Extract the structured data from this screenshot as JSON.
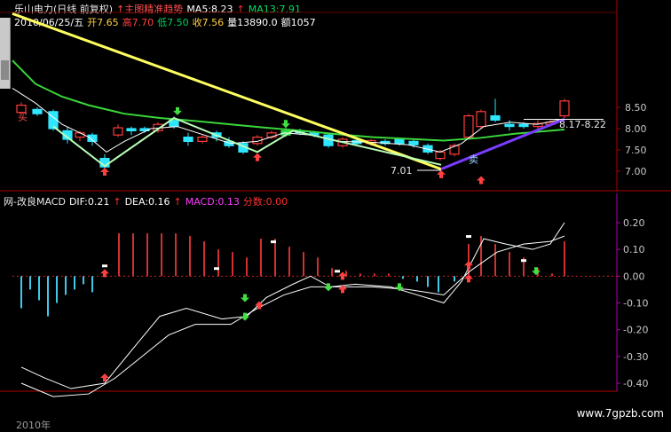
{
  "header": {
    "row1": [
      {
        "text": "乐山电力(日线 前复权)",
        "color": "#e8e8e8"
      },
      {
        "text": "↑主图精准趋势",
        "color": "#ff5050"
      },
      {
        "text": "MA5:8.23",
        "color": "#ffffff"
      },
      {
        "text": "↑",
        "color": "#ff3030"
      },
      {
        "text": "MA13:7.91",
        "color": "#00e060"
      }
    ],
    "row2": [
      {
        "text": "2010/06/25/五",
        "color": "#ffffff"
      },
      {
        "text": "开7.65",
        "color": "#ffd040"
      },
      {
        "text": "高7.70",
        "color": "#ff4040"
      },
      {
        "text": "低7.50",
        "color": "#00d060"
      },
      {
        "text": "收7.56",
        "color": "#ffd040"
      },
      {
        "text": "量13890.0",
        "color": "#ffffff"
      },
      {
        "text": "额1057",
        "color": "#ffffff"
      }
    ]
  },
  "macd_header": [
    {
      "text": "网-改良MACD",
      "color": "#e8e8e8"
    },
    {
      "text": "DIF:0.21",
      "color": "#ffffff"
    },
    {
      "text": "↑",
      "color": "#ff3030"
    },
    {
      "text": "DEA:0.16",
      "color": "#ffffff"
    },
    {
      "text": "↑",
      "color": "#ff3030"
    },
    {
      "text": "MACD:0.13",
      "color": "#ff3cff"
    },
    {
      "text": "分数:0.00",
      "color": "#ff3030"
    }
  ],
  "price_panel": {
    "y_ticks": [
      "8.50",
      "8.00",
      "7.50",
      "7.00"
    ],
    "annotations": [
      "8.17-8.22",
      "7.01"
    ],
    "signals": [
      "买",
      "卖"
    ]
  },
  "macd_panel": {
    "y_ticks": [
      "0.20",
      "0.10",
      "0.00",
      "-0.10",
      "-0.20",
      "-0.30",
      "-0.40"
    ]
  },
  "footer": {
    "watermark": "www.7gpzb.com",
    "bottom_tab": "2010年"
  },
  "colors": {
    "up_candle": "#ff3c3c",
    "down_candle": "#2ee6ff",
    "green_candle": "#2edc4a",
    "ma5": "#ffffff",
    "ma13": "#3ad63a",
    "trend_yellow": "#ffff60",
    "trend_green": "#b8ffb8",
    "trend_purple": "#7a3cff",
    "dif": "#ffffff",
    "dea": "#ffffff",
    "bar_up": "#d03030",
    "bar_down": "#40c8e8",
    "axis": "#b00000",
    "grid": "#6a0000",
    "axis_text": "#c8c8c8",
    "macd_axis": "#b000b0"
  }
}
